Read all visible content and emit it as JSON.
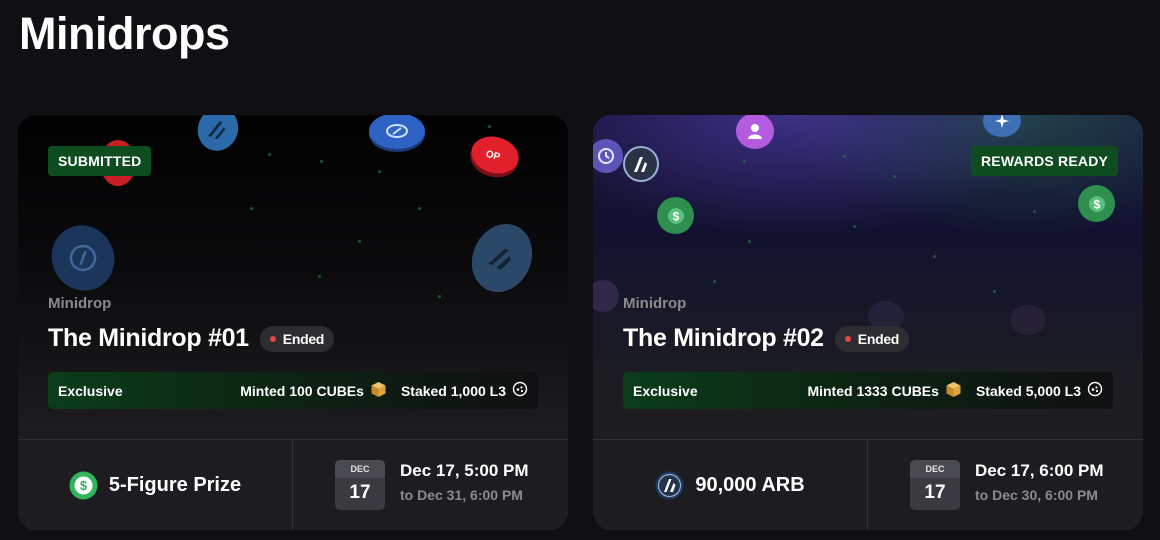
{
  "page": {
    "title": "Minidrops"
  },
  "colors": {
    "badge_bg": "#0f4d20",
    "ended_dot": "#e84545",
    "card_bg": "#1d1d21",
    "dollar_green": "#2fb55a",
    "arb_blue": "#1c3a5c"
  },
  "cards": [
    {
      "status_badge": "SUBMITTED",
      "eyebrow": "Minidrop",
      "title": "The Minidrop #01",
      "state": "Ended",
      "info": {
        "label": "Exclusive",
        "minted": "Minted 100 CUBEs",
        "staked": "Staked 1,000 L3",
        "minted_icon": "cube-icon",
        "staked_icon": "l3-token-icon"
      },
      "prize": {
        "label": "5-Figure Prize",
        "icon": "dollar-coin-icon"
      },
      "date": {
        "month": "DEC",
        "day": "17",
        "start": "Dec 17, 5:00 PM",
        "end": "to Dec 31, 6:00 PM"
      }
    },
    {
      "status_badge": "REWARDS READY",
      "eyebrow": "Minidrop",
      "title": "The Minidrop #02",
      "state": "Ended",
      "info": {
        "label": "Exclusive",
        "minted": "Minted 1333 CUBEs",
        "staked": "Staked 5,000 L3",
        "minted_icon": "cube-icon",
        "staked_icon": "l3-token-icon"
      },
      "prize": {
        "label": "90,000 ARB",
        "icon": "arbitrum-icon"
      },
      "date": {
        "month": "DEC",
        "day": "17",
        "start": "Dec 17, 6:00 PM",
        "end": "to Dec 30, 6:00 PM"
      }
    }
  ]
}
